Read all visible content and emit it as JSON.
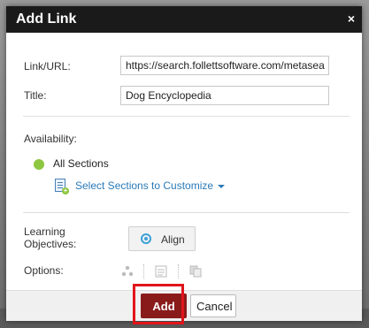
{
  "dialog": {
    "title": "Add Link",
    "close_glyph": "×"
  },
  "form": {
    "link_label": "Link/URL:",
    "link_value": "https://search.follettsoftware.com/metasea",
    "title_label": "Title:",
    "title_value": "Dog Encyclopedia",
    "availability_label": "Availability:",
    "availability_option": "All Sections",
    "select_sections_label": "Select Sections to Customize",
    "learning_objectives_label_line1": "Learning",
    "learning_objectives_label_line2": "Objectives:",
    "align_label": "Align",
    "options_label": "Options:"
  },
  "footer": {
    "add_label": "Add",
    "cancel_label": "Cancel"
  },
  "icons": {
    "availability_dot": "green-dot-icon",
    "sections": "list-add-icon",
    "align": "target-icon",
    "options": [
      "share-icon",
      "text-icon",
      "copy-icon"
    ]
  },
  "colors": {
    "titlebar": "#1a1a1a",
    "add_button": "#8a1b1b",
    "link": "#2a7ab8",
    "status_green": "#8dc63f",
    "highlight": "#e0151b"
  }
}
